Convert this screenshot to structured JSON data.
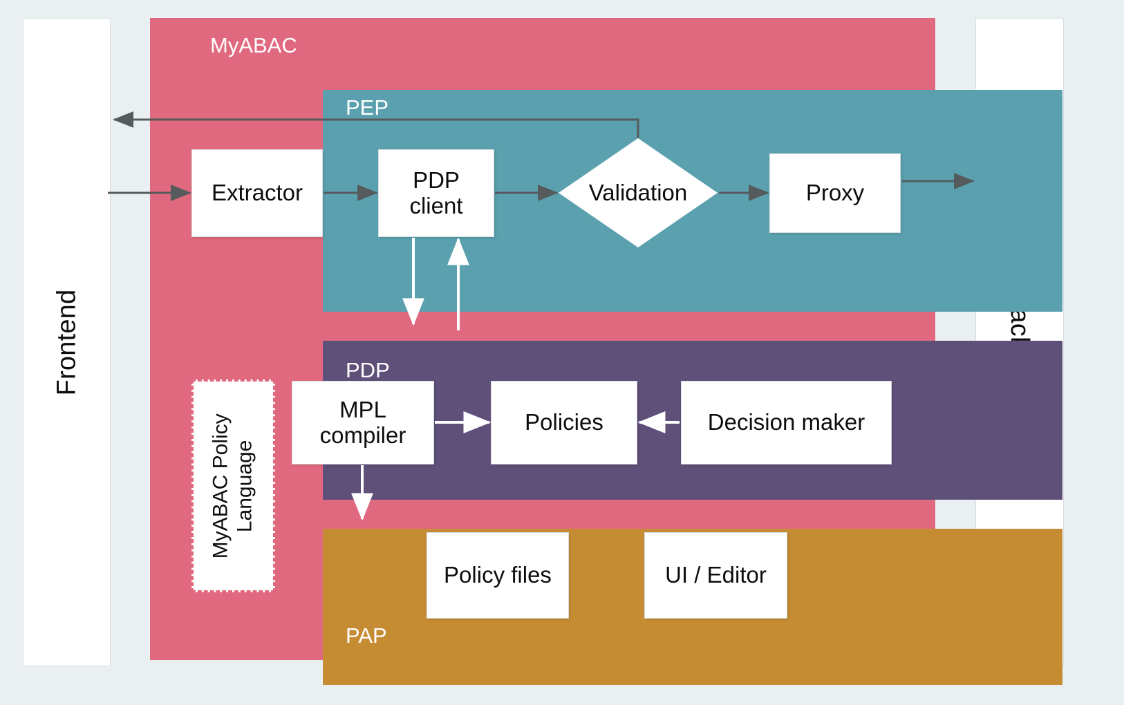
{
  "diagram": {
    "title": "MyABAC",
    "background_color": "#eaeff2"
  },
  "side_panels": {
    "frontend": {
      "label": "Frontend"
    },
    "backend": {
      "label": "Backend"
    }
  },
  "container": {
    "label": "MyABAC",
    "color": "#e0697f"
  },
  "layers": {
    "pep": {
      "label": "PEP",
      "color": "#5ba0ae"
    },
    "pdp": {
      "label": "PDP",
      "color": "#5f5079"
    },
    "pap": {
      "label": "PAP",
      "color": "#c68c33"
    }
  },
  "nodes": {
    "extractor": {
      "label": "Extractor",
      "shape": "rect"
    },
    "pdp_client": {
      "label": "PDP\nclient",
      "line1": "PDP",
      "line2": "client",
      "shape": "rect"
    },
    "validation": {
      "label": "Validation",
      "shape": "diamond"
    },
    "proxy": {
      "label": "Proxy",
      "shape": "rect"
    },
    "mpl_compiler": {
      "line1": "MPL",
      "line2": "compiler",
      "shape": "rect"
    },
    "policies": {
      "label": "Policies",
      "shape": "rect"
    },
    "decision_maker": {
      "label": "Decision maker",
      "shape": "rect"
    },
    "policy_files": {
      "label": "Policy files",
      "shape": "rect"
    },
    "ui_editor": {
      "label": "UI / Editor",
      "shape": "rect"
    },
    "policy_language": {
      "line1": "MyABAC Policy",
      "line2": "Language",
      "shape": "rect-dashed",
      "border_color": "#e0697f"
    }
  },
  "arrows": {
    "dark_color": "#555b5c",
    "light_color": "#ffffff",
    "list": [
      {
        "name": "frontend-to-extractor",
        "from": "Frontend",
        "to": "Extractor"
      },
      {
        "name": "extractor-to-pdp-client",
        "from": "Extractor",
        "to": "PDP client"
      },
      {
        "name": "pdp-client-to-validation",
        "from": "PDP client",
        "to": "Validation"
      },
      {
        "name": "validation-to-proxy",
        "from": "Validation",
        "to": "Proxy"
      },
      {
        "name": "proxy-to-backend",
        "from": "Proxy",
        "to": "Backend"
      },
      {
        "name": "validation-to-frontend",
        "from": "Validation",
        "to": "Frontend"
      },
      {
        "name": "pdp-client-to-pdp",
        "from": "PDP client",
        "to": "PDP"
      },
      {
        "name": "pdp-to-pdp-client",
        "from": "PDP",
        "to": "PDP client"
      },
      {
        "name": "mpl-compiler-to-policies",
        "from": "MPL compiler",
        "to": "Policies"
      },
      {
        "name": "decision-maker-to-policies",
        "from": "Decision maker",
        "to": "Policies"
      },
      {
        "name": "mpl-compiler-to-pap",
        "from": "MPL compiler",
        "to": "PAP"
      }
    ]
  }
}
